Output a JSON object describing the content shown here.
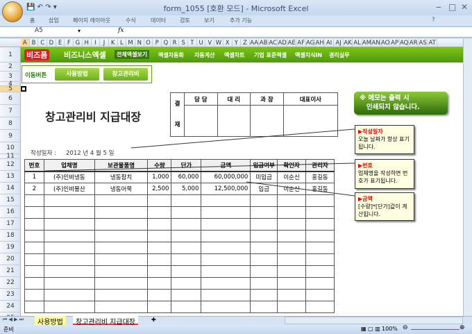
{
  "window": {
    "title": "form_1055  [호환 모드] - Microsoft Excel"
  },
  "ribbon": {
    "tabs": [
      "홈",
      "삽입",
      "페이지 레이아웃",
      "수식",
      "데이터",
      "검토",
      "보기",
      "추가 기능"
    ]
  },
  "formula_bar": {
    "name_box": "A5",
    "fx": "fx",
    "value": ""
  },
  "columns": [
    "A",
    "B",
    "C",
    "D",
    "E",
    "F",
    "G",
    "H",
    "I",
    "J",
    "K",
    "L",
    "M",
    "N",
    "O",
    "P",
    "Q",
    "R",
    "S",
    "T",
    "U",
    "V",
    "W",
    "X",
    "Y",
    "Z",
    "AA",
    "AB",
    "AC",
    "AD",
    "AE",
    "AF",
    "AG",
    "AH",
    "AI",
    "AJ",
    "AK",
    "AL",
    "AM",
    "AN",
    "AO",
    "AP",
    "AQ",
    "AR",
    "AS",
    "AT"
  ],
  "rows": [
    "1",
    "2",
    "3",
    "4",
    "5",
    "6",
    "7",
    "8",
    "9",
    "10",
    "11",
    "12",
    "13",
    "14",
    "15",
    "16",
    "17",
    "18",
    "19",
    "20",
    "21",
    "22",
    "23",
    "24",
    "25"
  ],
  "banner": {
    "logo1": "비즈폼",
    "logo2": "비즈니스엑셀",
    "nav": [
      "전체엑셀보기",
      "엑셀자동화",
      "자동계산",
      "엑셀차트",
      "기업 표준엑셀",
      "엑셀지식IN",
      "경리실무"
    ]
  },
  "move_buttons": {
    "label": "이동버튼",
    "buttons": [
      "사용방법",
      "창고관리비"
    ]
  },
  "doc": {
    "title": "창고관리비 지급대장",
    "date_label": "작성일자 :",
    "date": "2012 년  4 월  5 일"
  },
  "approval": {
    "side": [
      "결",
      "재"
    ],
    "headers": [
      "담  당",
      "대  리",
      "과  장",
      "대표이사"
    ]
  },
  "table": {
    "headers": [
      "번호",
      "업체명",
      "보관물품명",
      "수량",
      "단가",
      "금액",
      "입금여부",
      "확인자",
      "관리자"
    ],
    "rows": [
      [
        "1",
        "(주)인비냉동",
        "냉동참치",
        "1,000",
        "60,000",
        "60,000,000",
        "미입금",
        "이순신",
        "홍길동"
      ],
      [
        "2",
        "(주)인비물산",
        "냉동어묵",
        "2,500",
        "5,000",
        "12,500,000",
        "입금",
        "이순신",
        "홍길동"
      ]
    ],
    "empty_rows": 10
  },
  "memo_notice": "※ 메모는 출력 시\n   인쇄되지 않습니다.",
  "notes": [
    {
      "title": "▶작성일자",
      "body": "오늘 날짜가 항상 표기됩니다."
    },
    {
      "title": "▶번호",
      "body": "업체명을 작성하면 번호가 표기됩니다."
    },
    {
      "title": "▶금액",
      "body": "[수량]*[단가]값이 계산됩니다."
    }
  ],
  "sheet_tabs": [
    "사용방법",
    "창고관리비 지급대장"
  ],
  "status": {
    "text": "준비",
    "zoom": "100%"
  },
  "colors": {
    "accent_green": "#5aa510",
    "excel_blue": "#c5d6ec",
    "note_bg": "#ffffe1"
  }
}
